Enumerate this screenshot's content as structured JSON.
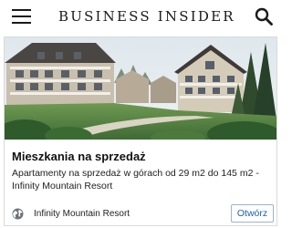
{
  "header": {
    "logo_text": "BUSINESS INSIDER",
    "menu_icon": "hamburger-menu-icon",
    "search_icon": "search-icon"
  },
  "ad": {
    "title": "Mieszkania na sprzedaż",
    "description": "Apartamenty na sprzedaż w górach od 29 m2 do 145 m2 - Infinity Mountain Resort",
    "advertiser": "Infinity Mountain Resort",
    "advertiser_icon": "globe-icon",
    "cta_label": "Otwórz",
    "cta_color": "#1a5fb4"
  }
}
